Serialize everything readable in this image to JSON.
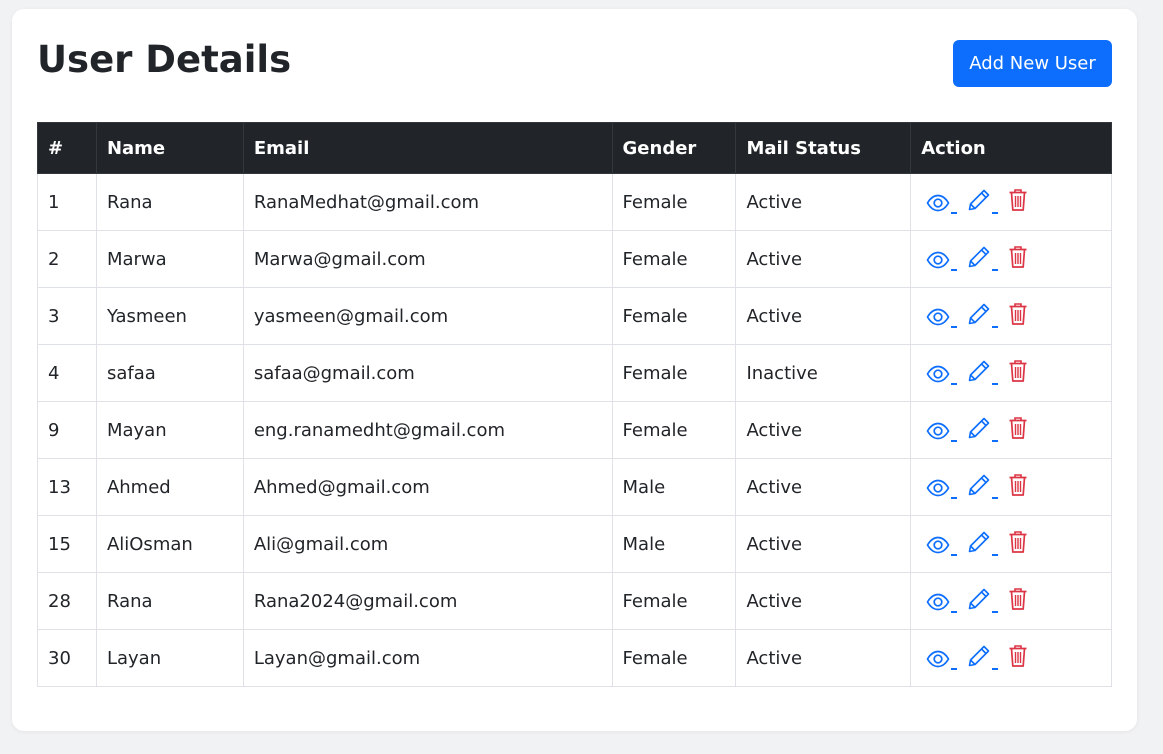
{
  "page": {
    "title": "User Details",
    "add_button_label": "Add New User"
  },
  "table": {
    "headers": [
      "#",
      "Name",
      "Email",
      "Gender",
      "Mail Status",
      "Action"
    ],
    "rows": [
      {
        "id": "1",
        "name": "Rana",
        "email": "RanaMedhat@gmail.com",
        "gender": "Female",
        "status": "Active"
      },
      {
        "id": "2",
        "name": "Marwa",
        "email": "Marwa@gmail.com",
        "gender": "Female",
        "status": "Active"
      },
      {
        "id": "3",
        "name": "Yasmeen",
        "email": "yasmeen@gmail.com",
        "gender": "Female",
        "status": "Active"
      },
      {
        "id": "4",
        "name": "safaa",
        "email": "safaa@gmail.com",
        "gender": "Female",
        "status": "Inactive"
      },
      {
        "id": "9",
        "name": "Mayan",
        "email": "eng.ranamedht@gmail.com",
        "gender": "Female",
        "status": "Active"
      },
      {
        "id": "13",
        "name": "Ahmed",
        "email": "Ahmed@gmail.com",
        "gender": "Male",
        "status": "Active"
      },
      {
        "id": "15",
        "name": "AliOsman",
        "email": "Ali@gmail.com",
        "gender": "Male",
        "status": "Active"
      },
      {
        "id": "28",
        "name": "Rana",
        "email": "Rana2024@gmail.com",
        "gender": "Female",
        "status": "Active"
      },
      {
        "id": "30",
        "name": "Layan",
        "email": "Layan@gmail.com",
        "gender": "Female",
        "status": "Active"
      }
    ]
  },
  "icons": {
    "view": "eye-icon",
    "edit": "pencil-icon",
    "delete": "trash-icon"
  },
  "colors": {
    "primary": "#0d6efd",
    "danger": "#dc3545",
    "header_bg": "#212529"
  }
}
